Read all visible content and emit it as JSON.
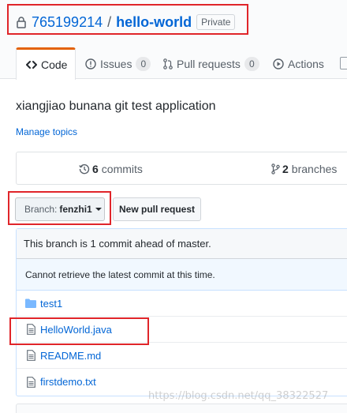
{
  "repo": {
    "owner": "765199214",
    "separator": "/",
    "name": "hello-world",
    "visibility": "Private"
  },
  "tabs": [
    {
      "label": "Code",
      "icon": "code-icon",
      "active": true
    },
    {
      "label": "Issues",
      "icon": "issue-opened-icon",
      "count": "0"
    },
    {
      "label": "Pull requests",
      "icon": "git-pull-request-icon",
      "count": "0"
    },
    {
      "label": "Actions",
      "icon": "play-icon"
    }
  ],
  "description": "xiangjiao bunana git test application",
  "manage_topics": "Manage topics",
  "summary": {
    "commits_count": "6",
    "commits_label": "commits",
    "branches_count": "2",
    "branches_label": "branches"
  },
  "branch_selector": {
    "label": "Branch:",
    "value": "fenzhi1"
  },
  "new_pull_request": "New pull request",
  "ahead_message": "This branch is 1 commit ahead of master.",
  "commit_error": "Cannot retrieve the latest commit at this time.",
  "files": [
    {
      "name": "test1",
      "type": "folder"
    },
    {
      "name": "HelloWorld.java",
      "type": "file"
    },
    {
      "name": "README.md",
      "type": "file"
    },
    {
      "name": "firstdemo.txt",
      "type": "file"
    }
  ],
  "watermark": "https://blog.csdn.net/qq_38322527",
  "colors": {
    "link": "#0366d6",
    "highlight_box": "#e0252a",
    "active_tab_border": "#e36209",
    "folder_icon": "#79b8ff"
  }
}
